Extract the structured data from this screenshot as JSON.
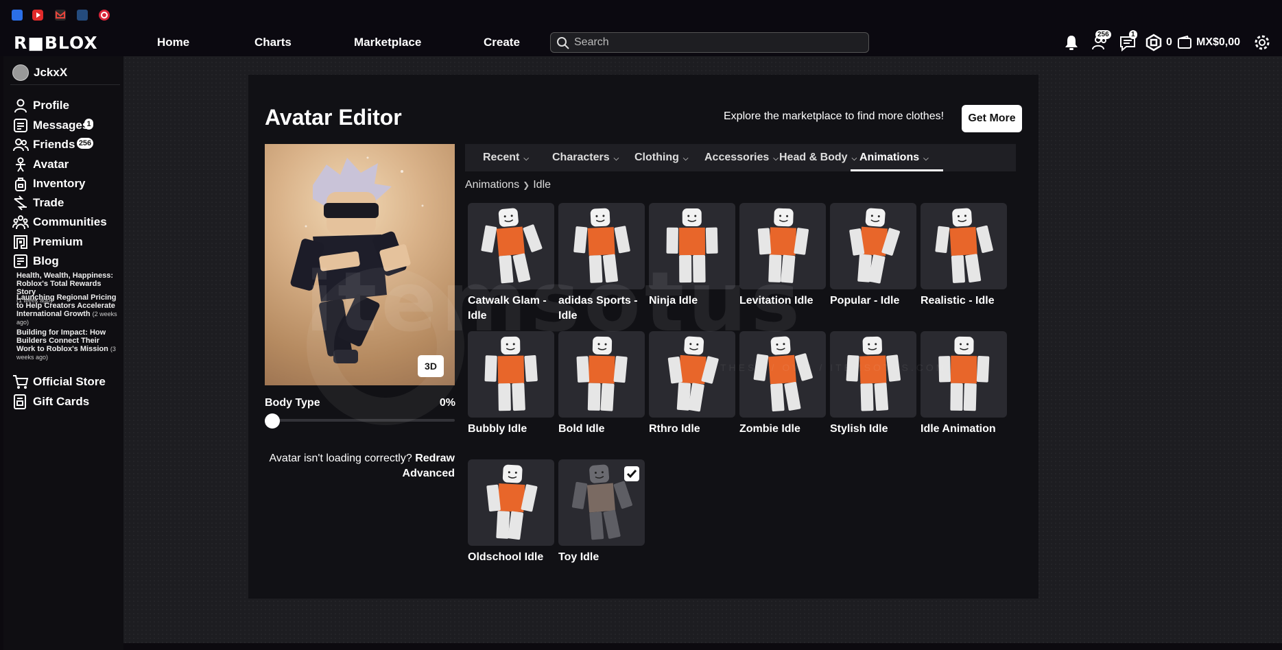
{
  "header": {
    "logo": "R■BLOX",
    "nav": [
      "Home",
      "Charts",
      "Marketplace",
      "Create"
    ],
    "search_placeholder": "Search",
    "friend_requests": "256",
    "messages_count": "1",
    "robux": "0",
    "currency": "MX$0,00"
  },
  "sidebar": {
    "username": "JckxX",
    "items": [
      {
        "label": "Profile",
        "icon": "person-icon"
      },
      {
        "label": "Messages",
        "icon": "messages-icon",
        "badge": "1"
      },
      {
        "label": "Friends",
        "icon": "friends-icon",
        "badge": "256"
      },
      {
        "label": "Avatar",
        "icon": "avatar-icon"
      },
      {
        "label": "Inventory",
        "icon": "inventory-icon"
      },
      {
        "label": "Trade",
        "icon": "trade-icon"
      },
      {
        "label": "Communities",
        "icon": "communities-icon"
      },
      {
        "label": "Premium",
        "icon": "premium-icon"
      },
      {
        "label": "Blog",
        "icon": "blog-icon"
      }
    ],
    "blog_posts": [
      {
        "title": "Health, Wealth, Happiness: Roblox's Total Rewards Story",
        "ago": "(1 week ago)"
      },
      {
        "title": "Launching Regional Pricing to Help Creators Accelerate International Growth",
        "ago": "(2 weeks ago)"
      },
      {
        "title": "Building for Impact: How Builders Connect Their Work to Roblox's Mission",
        "ago": "(3 weeks ago)"
      }
    ],
    "bottom_items": [
      {
        "label": "Official Store",
        "icon": "cart-icon"
      },
      {
        "label": "Gift Cards",
        "icon": "gift-card-icon"
      }
    ]
  },
  "editor": {
    "title": "Avatar Editor",
    "explore_text": "Explore the marketplace to find more clothes!",
    "get_more": "Get More",
    "view_3d": "3D",
    "body_type_label": "Body Type",
    "body_type_value": "0%",
    "body_type_fraction": 0,
    "hint_text": "Avatar isn't loading correctly?",
    "redraw": "Redraw",
    "advanced": "Advanced",
    "tabs": [
      "Recent",
      "Characters",
      "Clothing",
      "Accessories",
      "Head & Body",
      "Animations"
    ],
    "active_tab": "Animations",
    "breadcrumb": [
      "Animations",
      "Idle"
    ],
    "items": [
      {
        "label": "Catwalk Glam - Idle",
        "color": "#e8662a"
      },
      {
        "label": "adidas Sports - Idle",
        "color": "#e8662a"
      },
      {
        "label": "Ninja Idle",
        "color": "#e8662a"
      },
      {
        "label": "Levitation Idle",
        "color": "#e8662a"
      },
      {
        "label": "Popular - Idle",
        "color": "#e8662a"
      },
      {
        "label": "Realistic - Idle",
        "color": "#e8662a"
      },
      {
        "label": "Bubbly Idle",
        "color": "#e8662a"
      },
      {
        "label": "Bold Idle",
        "color": "#e8662a"
      },
      {
        "label": "Rthro Idle",
        "color": "#e8662a"
      },
      {
        "label": "Zombie Idle",
        "color": "#e8662a"
      },
      {
        "label": "Stylish Idle",
        "color": "#e8662a"
      },
      {
        "label": "Idle Animation",
        "color": "#e8662a"
      },
      {
        "label": "Oldschool Idle",
        "color": "#e8662a"
      },
      {
        "label": "Toy Idle",
        "color": "#7a6a62",
        "selected": true
      }
    ]
  },
  "watermark": {
    "text": "itemsotus",
    "sub": "THESE / OWN / ITEMSOTUS.COM"
  }
}
